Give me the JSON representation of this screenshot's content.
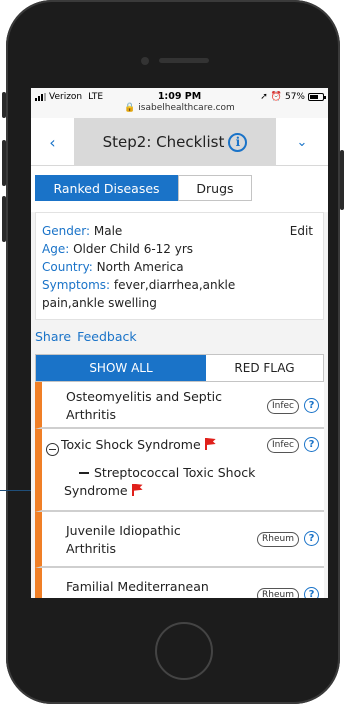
{
  "status_bar": {
    "carrier": "Verizon",
    "network": "LTE",
    "time": "1:09 PM",
    "url": "isabelhealthcare.com",
    "battery": "57%"
  },
  "header": {
    "title": "Step2: Checklist",
    "info_glyph": "i"
  },
  "tabs": {
    "ranked": "Ranked Diseases",
    "drugs": "Drugs"
  },
  "patient": {
    "gender_label": "Gender:",
    "gender": "Male",
    "age_label": "Age:",
    "age": "Older Child 6-12 yrs",
    "country_label": "Country:",
    "country": "North America",
    "symptoms_label": "Symptoms:",
    "symptoms_line1": "fever,diarrhea,ankle",
    "symptoms_line2": "pain,ankle swelling",
    "edit": "Edit"
  },
  "links": {
    "share": "Share",
    "feedback": "Feedback"
  },
  "filters": {
    "show_all": "SHOW ALL",
    "red_flag": "RED FLAG"
  },
  "diseases": [
    {
      "line1": "Osteomyelitis and Septic",
      "line2": "Arthritis",
      "badge": "Infec"
    },
    {
      "line1": "Toxic Shock Syndrome",
      "badge": "Infec",
      "red_flag": true,
      "sub_line1": "Streptococcal Toxic Shock",
      "sub_line2": "Syndrome"
    },
    {
      "line1": "Juvenile Idiopathic",
      "line2": "Arthritis",
      "badge": "Rheum"
    },
    {
      "line1": "Familial Mediterranean",
      "badge": "Rheum"
    }
  ],
  "help_glyph": "?",
  "colors": {
    "accent_blue": "#1a73c8",
    "category_orange": "#f07f26",
    "flag_red": "#e0201b"
  }
}
